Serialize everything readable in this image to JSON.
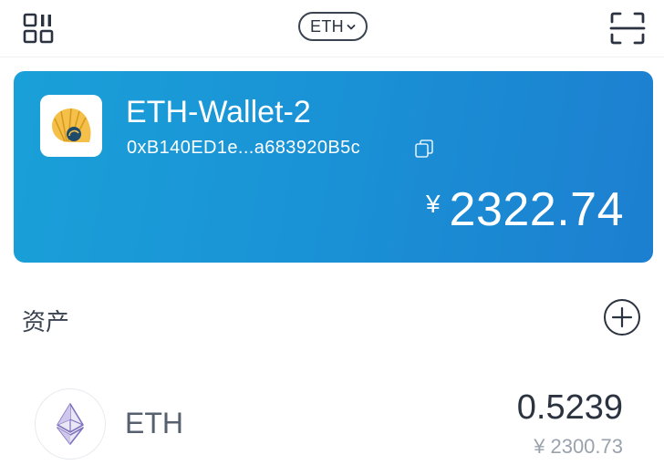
{
  "header": {
    "network": "ETH",
    "menu_icon": "menu-grid-icon",
    "scan_icon": "scan-icon",
    "chevron_icon": "chevron-down-icon"
  },
  "wallet": {
    "name": "ETH-Wallet-2",
    "address": "0xB140ED1e...a683920B5c",
    "currency_symbol": "¥",
    "balance": "2322.74",
    "logo_icon": "nautilus-shell-logo",
    "copy_icon": "copy-icon",
    "card_gradient": [
      "#1aa0d8",
      "#1c7fd0"
    ]
  },
  "assets": {
    "title": "资产",
    "add_icon": "plus-circle-icon",
    "items": [
      {
        "symbol": "ETH",
        "amount": "0.5239",
        "fiat_currency": "¥",
        "fiat_value": "2300.73",
        "icon": "ethereum-icon"
      }
    ]
  },
  "colors": {
    "card_blue": "#1a93d6",
    "ethereum_purple": "#8a7ec3",
    "logo_yellow": "#f5c04a"
  }
}
